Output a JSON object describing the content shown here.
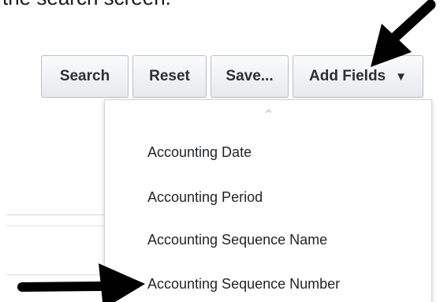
{
  "caption": {
    "text": "the search screen."
  },
  "toolbar": {
    "search_label": "Search",
    "reset_label": "Reset",
    "save_label": "Save...",
    "add_fields_label": "Add Fields",
    "caret_glyph": "▼"
  },
  "menu": {
    "scroll_up_glyph": "⌃",
    "items": [
      {
        "label": "Accounting Date"
      },
      {
        "label": "Accounting Period"
      },
      {
        "label": "Accounting Sequence Name"
      },
      {
        "label": "Accounting Sequence Number"
      }
    ]
  },
  "colors": {
    "arrow": "#000000",
    "button_border": "#b9c0c8",
    "menu_border": "#cfd3d8"
  }
}
